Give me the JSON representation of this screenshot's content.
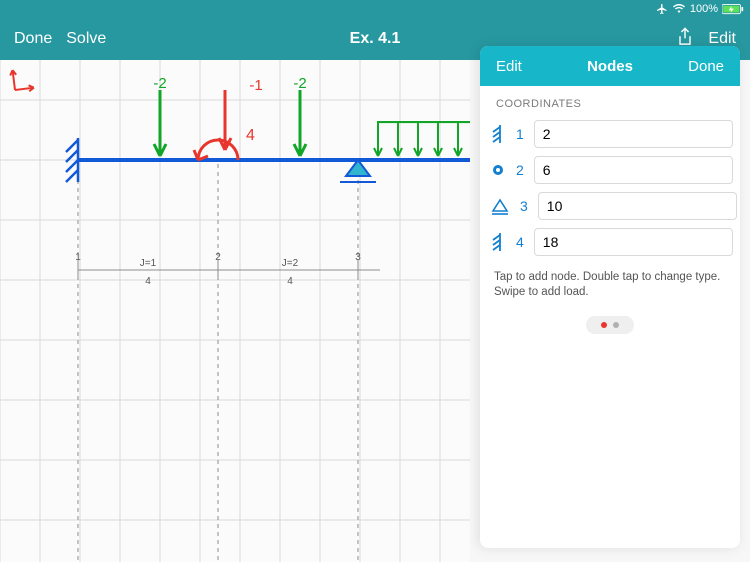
{
  "status": {
    "battery": "100%"
  },
  "toolbar": {
    "done": "Done",
    "solve": "Solve",
    "title": "Ex. 4.1",
    "edit": "Edit"
  },
  "panel": {
    "edit": "Edit",
    "title": "Nodes",
    "done": "Done",
    "section": "COORDINATES",
    "nodes": [
      {
        "id": "1",
        "x": "2",
        "type": "fixed"
      },
      {
        "id": "2",
        "x": "6",
        "type": "point"
      },
      {
        "id": "3",
        "x": "10",
        "type": "pin"
      },
      {
        "id": "4",
        "x": "18",
        "type": "fixed"
      }
    ],
    "help": "Tap to add node. Double tap to change type. Swipe to add load."
  },
  "beam": {
    "loads": [
      {
        "label": "-2",
        "color": "green"
      },
      {
        "label": "-1",
        "color": "red"
      },
      {
        "label": "-2",
        "color": "green"
      }
    ],
    "moment_label": "4",
    "joints": [
      {
        "id": "1",
        "anno": ""
      },
      {
        "id": "2",
        "anno": "J=1"
      },
      {
        "id": "3",
        "anno": "J=2"
      }
    ],
    "spans": [
      "4",
      "4"
    ]
  },
  "chart_data": {
    "type": "diagram",
    "nodes": [
      {
        "id": 1,
        "x": 2,
        "support": "fixed-left"
      },
      {
        "id": 2,
        "x": 6,
        "support": "none"
      },
      {
        "id": 3,
        "x": 10,
        "support": "pin"
      },
      {
        "id": 4,
        "x": 18,
        "support": "fixed-right"
      }
    ],
    "point_loads": [
      {
        "x_approx": 3.5,
        "magnitude": -2
      },
      {
        "x_approx": 5.3,
        "magnitude": -1
      },
      {
        "x_approx": 7.4,
        "magnitude": -2
      }
    ],
    "moment": {
      "x": 6,
      "magnitude": 4,
      "sense": "ccw"
    },
    "distributed_load": {
      "from_node": 3,
      "span": "right",
      "color": "green"
    },
    "j_markers": [
      {
        "node": 2,
        "label": "J=1"
      },
      {
        "node": 3,
        "label": "J=2"
      }
    ],
    "spans_labeled": [
      4,
      4
    ]
  }
}
